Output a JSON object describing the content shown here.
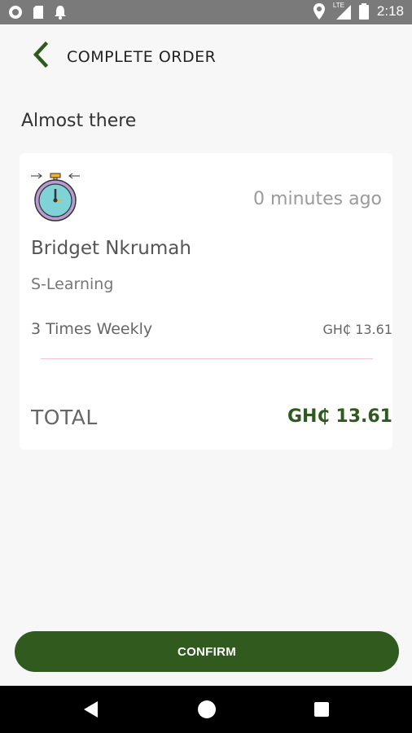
{
  "status_bar": {
    "time": "2:18",
    "network": "LTE",
    "left_icons": [
      "circle-icon",
      "sd-card-icon",
      "notification-bell-icon"
    ],
    "right_icons": [
      "location-icon",
      "signal-icon",
      "battery-icon"
    ]
  },
  "header": {
    "title": "COMPLETE ORDER",
    "back_icon": "chevron-left-icon",
    "accent_color": "#2f5a1e"
  },
  "page": {
    "subtitle": "Almost there"
  },
  "order": {
    "icon": "stopwatch-icon",
    "time_ago": "0 minutes ago",
    "customer_name": "Bridget Nkrumah",
    "service": "S-Learning",
    "frequency": "3 Times Weekly",
    "price": "GH₵ 13.61",
    "total_label": "TOTAL",
    "total_value": "GH₵ 13.61"
  },
  "actions": {
    "confirm_label": "CONFIRM",
    "confirm_color": "#315a1f"
  },
  "nav_bar": {
    "icons": [
      "back-triangle-icon",
      "home-circle-icon",
      "recents-square-icon"
    ]
  }
}
